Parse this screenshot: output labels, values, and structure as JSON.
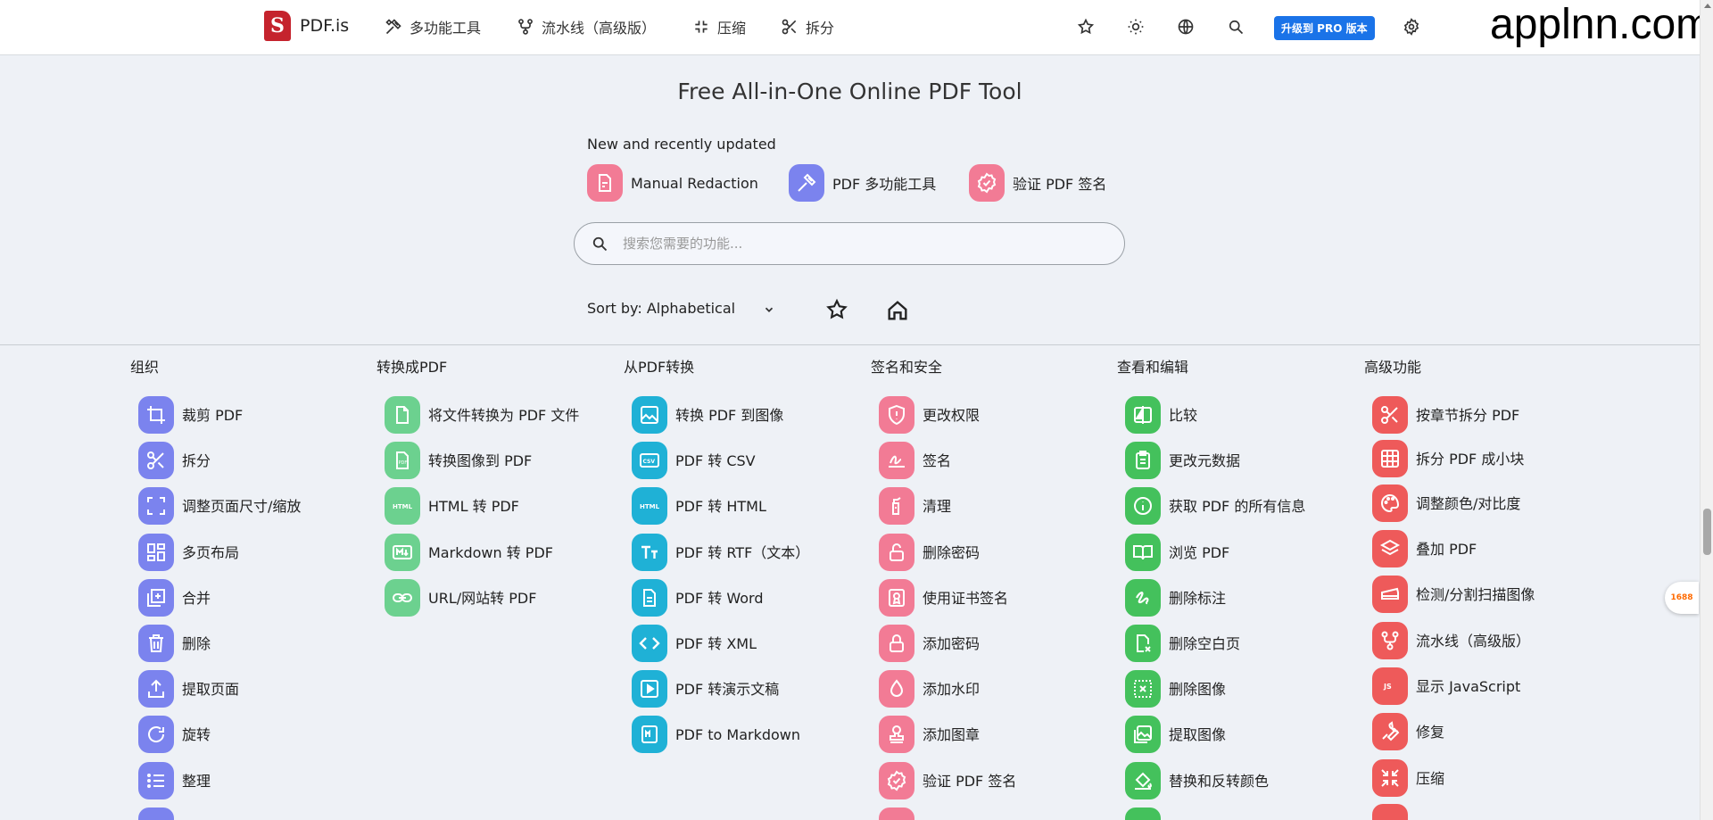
{
  "nav": {
    "brand": "PDF.is",
    "logo_letter": "S",
    "items": [
      {
        "label": "多功能工具",
        "icon": "tools-icon"
      },
      {
        "label": "流水线（高级版）",
        "icon": "pipeline-icon"
      },
      {
        "label": "压缩",
        "icon": "compress-icon"
      },
      {
        "label": "拆分",
        "icon": "scissors-icon"
      }
    ],
    "pro_button": "升级到 PRO 版本",
    "watermark": "applnn.com"
  },
  "hero": {
    "title": "Free All-in-One Online PDF Tool",
    "recent_label": "New and recently updated",
    "recent": [
      {
        "label": "Manual Redaction",
        "color": "#f27b95"
      },
      {
        "label": "PDF 多功能工具",
        "color": "#7b83ee"
      },
      {
        "label": "验证 PDF 签名",
        "color": "#f27b95"
      }
    ]
  },
  "search": {
    "placeholder": "搜索您需要的功能..."
  },
  "sort": {
    "label": "Sort by: Alphabetical"
  },
  "badge": {
    "label": "1688"
  },
  "colors": {
    "organize": "#7b83ee",
    "to_pdf": "#6cd18f",
    "from_pdf": "#1fb1d6",
    "security": "#f27b95",
    "edit": "#44c15c",
    "advanced": "#ee5a5a"
  },
  "columns": [
    {
      "title": "组织",
      "tools": [
        "裁剪 PDF",
        "拆分",
        "调整页面尺寸/缩放",
        "多页布局",
        "合并",
        "删除",
        "提取页面",
        "旋转",
        "整理"
      ]
    },
    {
      "title": "转换成PDF",
      "tools": [
        "将文件转换为 PDF 文件",
        "转换图像到 PDF",
        "HTML 转 PDF",
        "Markdown 转 PDF",
        "URL/网站转 PDF"
      ]
    },
    {
      "title": "从PDF转换",
      "tools": [
        "转换 PDF 到图像",
        "PDF 转 CSV",
        "PDF 转 HTML",
        "PDF 转 RTF（文本）",
        "PDF 转 Word",
        "PDF 转 XML",
        "PDF 转演示文稿",
        "PDF to Markdown"
      ]
    },
    {
      "title": "签名和安全",
      "tools": [
        "更改权限",
        "签名",
        "清理",
        "删除密码",
        "使用证书签名",
        "添加密码",
        "添加水印",
        "添加图章",
        "验证 PDF 签名"
      ]
    },
    {
      "title": "查看和编辑",
      "tools": [
        "比较",
        "更改元数据",
        "获取 PDF 的所有信息",
        "浏览 PDF",
        "删除标注",
        "删除空白页",
        "删除图像",
        "提取图像",
        "替换和反转颜色"
      ]
    },
    {
      "title": "高级功能",
      "tools": [
        "按章节拆分 PDF",
        "拆分 PDF 成小块",
        "调整颜色/对比度",
        "叠加 PDF",
        "检测/分割扫描图像",
        "流水线（高级版）",
        "显示 JavaScript",
        "修复",
        "压缩"
      ]
    }
  ]
}
